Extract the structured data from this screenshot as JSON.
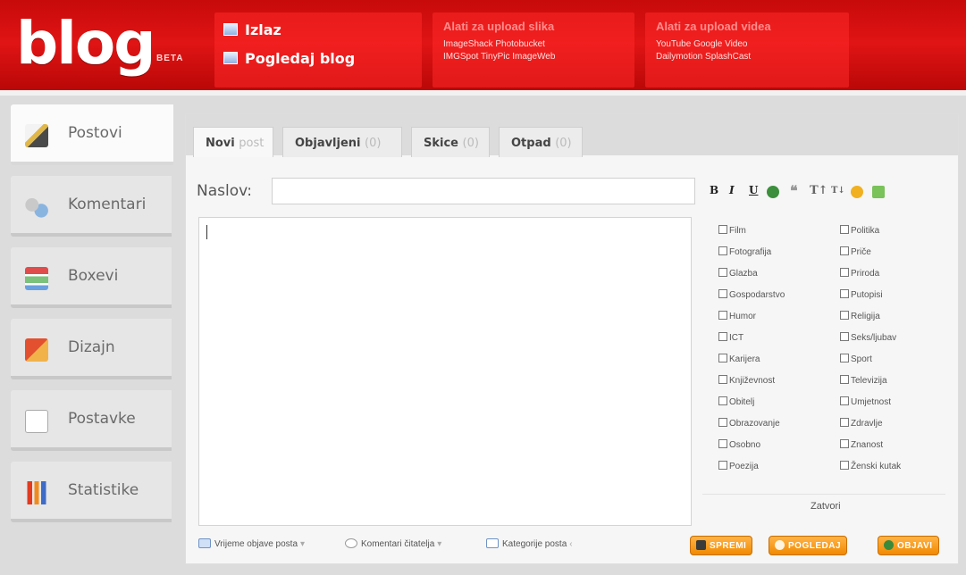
{
  "header": {
    "logo": "blog",
    "beta": "BETA",
    "links": [
      "Izlaz",
      "Pogledaj blog"
    ],
    "image_tools": {
      "title": "Alati za upload slika",
      "line1": "ImageShack  Photobucket",
      "line2": "IMGSpot  TinyPic  ImageWeb"
    },
    "video_tools": {
      "title": "Alati za upload videa",
      "line1": "YouTube  Google Video",
      "line2": "Dailymotion  SplashCast"
    }
  },
  "sidebar": {
    "items": [
      {
        "label": "Postovi",
        "icon": "pencil-icon"
      },
      {
        "label": "Komentari",
        "icon": "comments-icon"
      },
      {
        "label": "Boxevi",
        "icon": "boxes-icon"
      },
      {
        "label": "Dizajn",
        "icon": "design-icon"
      },
      {
        "label": "Postavke",
        "icon": "settings-icon"
      },
      {
        "label": "Statistike",
        "icon": "stats-icon"
      }
    ]
  },
  "tabs": [
    {
      "label": "Novi",
      "suffix": "post"
    },
    {
      "label": "Objavljeni",
      "suffix": "(0)"
    },
    {
      "label": "Skice",
      "suffix": "(0)"
    },
    {
      "label": "Otpad",
      "suffix": "(0)"
    }
  ],
  "editor": {
    "title_label": "Naslov:",
    "title_value": "",
    "content": ""
  },
  "toolbar": [
    "B",
    "I",
    "U",
    "link-icon",
    "quote-icon",
    "font-larger-icon",
    "font-smaller-icon",
    "search-icon",
    "image-icon"
  ],
  "categories": {
    "left": [
      "Film",
      "Fotografija",
      "Glazba",
      "Gospodarstvo",
      "Humor",
      "ICT",
      "Karijera",
      "Književnost",
      "Obitelj",
      "Obrazovanje",
      "Osobno",
      "Poezija"
    ],
    "right": [
      "Politika",
      "Priče",
      "Priroda",
      "Putopisi",
      "Religija",
      "Seks/ljubav",
      "Sport",
      "Televizija",
      "Umjetnost",
      "Zdravlje",
      "Znanost",
      "Ženski kutak"
    ],
    "close_label": "Zatvori"
  },
  "footer": {
    "publish_time": "Vrijeme objave posta",
    "comments": "Komentari čitatelja",
    "categories": "Kategorije posta"
  },
  "actions": [
    "SPREMI",
    "POGLEDAJ",
    "OBJAVI"
  ],
  "colors": {
    "header_red": "#d40f0f",
    "button_orange": "#f29000"
  }
}
